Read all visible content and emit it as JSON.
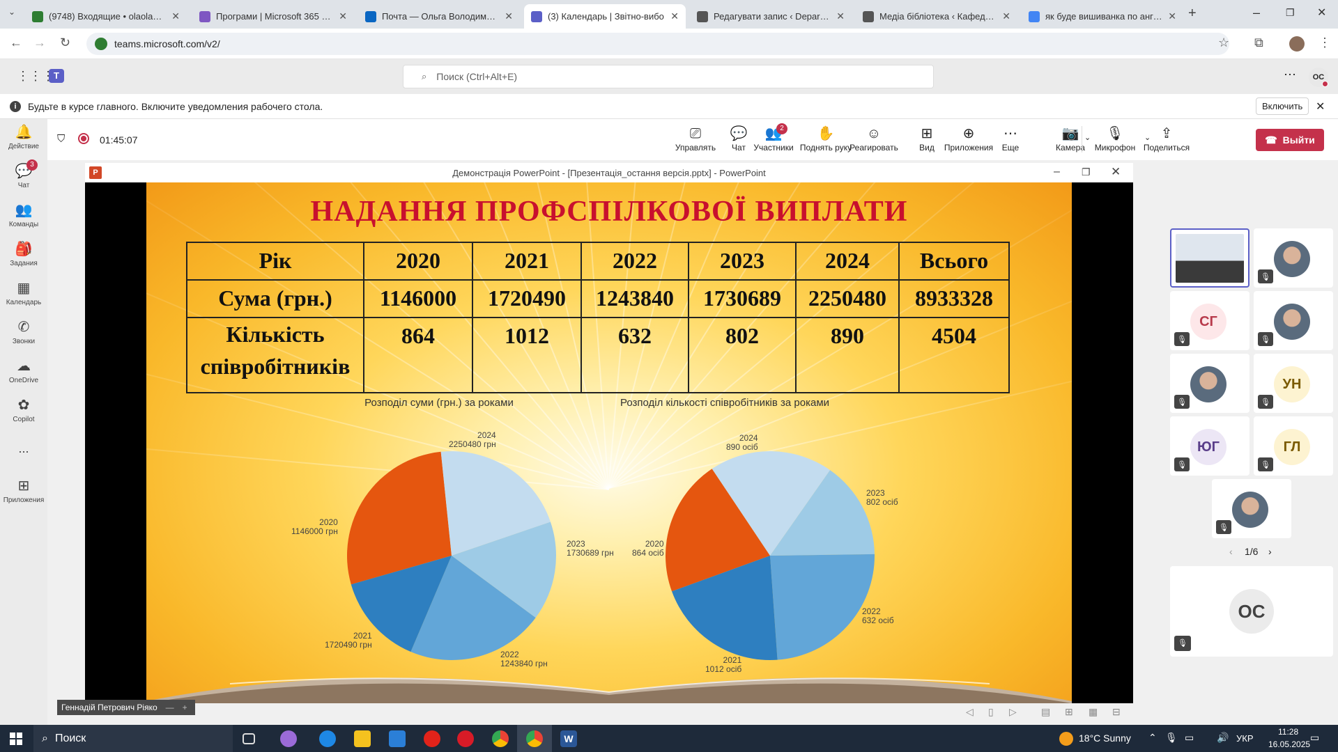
{
  "browser": {
    "tabs": [
      {
        "title": "(9748) Входящие • olaolaola@",
        "color": "#2e7d32"
      },
      {
        "title": "Програми | Microsoft 365 Copi",
        "color": "#7e57c2"
      },
      {
        "title": "Почта — Ольга Володимирівн",
        "color": "#0a66c2"
      },
      {
        "title": "(3) Календарь | Звітно-вибо",
        "color": "#5b5fc7",
        "active": true
      },
      {
        "title": "Редагувати запис ‹ Departmen",
        "color": "#555"
      },
      {
        "title": "Медіа бібліотека ‹ Кафедра \"",
        "color": "#555"
      },
      {
        "title": "як буде вишиванка по англ -",
        "color": "#4285f4"
      }
    ],
    "url": "teams.microsoft.com/v2/"
  },
  "teams": {
    "search_placeholder": "Поиск (Ctrl+Alt+E)",
    "profile_initials": "ОС",
    "notification_text": "Будьте в курсе главного. Включите уведомления рабочего стола.",
    "notification_button": "Включить",
    "rail": [
      {
        "label": "Действие",
        "icon": "bell-icon"
      },
      {
        "label": "Чат",
        "icon": "chat-icon",
        "badge": "3"
      },
      {
        "label": "Команды",
        "icon": "teams-icon"
      },
      {
        "label": "Задания",
        "icon": "assignments-icon"
      },
      {
        "label": "Календарь",
        "icon": "calendar-icon"
      },
      {
        "label": "Звонки",
        "icon": "phone-icon"
      },
      {
        "label": "OneDrive",
        "icon": "cloud-icon"
      },
      {
        "label": "Copilot",
        "icon": "copilot-icon"
      },
      {
        "label": "...",
        "icon": "more-icon"
      },
      {
        "label": "Приложения",
        "icon": "apps-icon"
      }
    ]
  },
  "meeting": {
    "timer": "01:45:07",
    "controls": [
      {
        "label": "Управлять",
        "icon": "share-control-icon"
      },
      {
        "label": "Чат",
        "icon": "chat-icon"
      },
      {
        "label": "Участники",
        "icon": "people-icon",
        "badge": "2"
      },
      {
        "label": "Поднять руку",
        "icon": "hand-icon"
      },
      {
        "label": "Реагировать",
        "icon": "emoji-icon"
      },
      {
        "label": "Вид",
        "icon": "grid-icon"
      },
      {
        "label": "Приложения",
        "icon": "add-app-icon"
      },
      {
        "label": "Еще",
        "icon": "more-icon"
      },
      {
        "label": "Камера",
        "icon": "camera-off-icon"
      },
      {
        "label": "Микрофон",
        "icon": "mic-off-icon"
      },
      {
        "label": "Поделиться",
        "icon": "share-icon"
      }
    ],
    "leave_label": "Выйти",
    "presenter_name": "Геннадій Петрович Ріяко",
    "page_indicator": "1/6",
    "participants": [
      {
        "initials": "",
        "kind": "video"
      },
      {
        "initials": "",
        "kind": "photo"
      },
      {
        "initials": "СГ",
        "kind": "initials",
        "bg": "#fde7e9",
        "fg": "#b83b4c"
      },
      {
        "initials": "",
        "kind": "photo"
      },
      {
        "initials": "",
        "kind": "photo"
      },
      {
        "initials": "УН",
        "kind": "initials",
        "bg": "#fdf3d1",
        "fg": "#7a5a00"
      },
      {
        "initials": "ЮГ",
        "kind": "initials",
        "bg": "#ece6f5",
        "fg": "#5a3e8a"
      },
      {
        "initials": "ГЛ",
        "kind": "initials",
        "bg": "#fdf3d1",
        "fg": "#7a5a00"
      },
      {
        "initials": "",
        "kind": "photo"
      }
    ],
    "self_initials": "ОС"
  },
  "powerpoint": {
    "window_title": "Демонстрація PowerPoint - [Презентація_остання версія.pptx] - PowerPoint",
    "slide_title": "НАДАННЯ ПРОФСПІЛКОВОЇ ВИПЛАТИ",
    "table": {
      "header": [
        "Рік",
        "2020",
        "2021",
        "2022",
        "2023",
        "2024",
        "Всього"
      ],
      "rows": [
        [
          "Сума (грн.)",
          "1146000",
          "1720490",
          "1243840",
          "1730689",
          "2250480",
          "8933328"
        ],
        [
          "Кількість співробітників",
          "864",
          "1012",
          "632",
          "802",
          "890",
          "4504"
        ]
      ]
    }
  },
  "chart_data": [
    {
      "type": "pie",
      "title": "Розподіл суми (грн.) за роками",
      "categories": [
        "2020",
        "2021",
        "2022",
        "2023",
        "2024"
      ],
      "values": [
        1146000,
        1720490,
        1243840,
        1730689,
        2250480
      ],
      "labels": [
        "2020\n1146000 грн",
        "2021\n1720490 грн",
        "2022\n1243840 грн",
        "2023\n1730689 грн",
        "2024\n2250480 грн"
      ],
      "colors": [
        "#2e7fc0",
        "#62a6d8",
        "#9ecbe6",
        "#c3dcef",
        "#e5560f"
      ]
    },
    {
      "type": "pie",
      "title": "Розподіл кількості співробітників за роками",
      "categories": [
        "2020",
        "2021",
        "2022",
        "2023",
        "2024"
      ],
      "values": [
        864,
        1012,
        632,
        802,
        890
      ],
      "labels": [
        "2020\n864 осіб",
        "2021\n1012 осіб",
        "2022\n632 осіб",
        "2023\n802 осіб",
        "2024\n890 осіб"
      ],
      "colors": [
        "#2e7fc0",
        "#62a6d8",
        "#9ecbe6",
        "#c3dcef",
        "#e5560f"
      ]
    }
  ],
  "taskbar": {
    "search_label": "Поиск",
    "weather": "18°C  Sunny",
    "language": "УКР",
    "time": "11:28",
    "date": "16.05.2025"
  }
}
